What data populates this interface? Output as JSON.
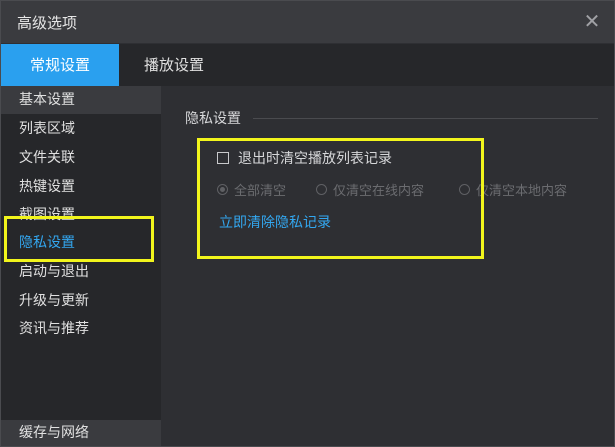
{
  "window": {
    "title": "高级选项"
  },
  "tabs": [
    {
      "label": "常规设置",
      "active": true
    },
    {
      "label": "播放设置",
      "active": false
    }
  ],
  "sidebar": {
    "items": [
      {
        "label": "基本设置"
      },
      {
        "label": "列表区域"
      },
      {
        "label": "文件关联"
      },
      {
        "label": "热键设置"
      },
      {
        "label": "截图设置"
      },
      {
        "label": "隐私设置",
        "selected": true
      },
      {
        "label": "启动与退出"
      },
      {
        "label": "升级与更新"
      },
      {
        "label": "资讯与推荐"
      }
    ],
    "bottom_item": "缓存与网络"
  },
  "privacy": {
    "section_title": "隐私设置",
    "checkbox_label": "退出时清空播放列表记录",
    "checkbox_checked": false,
    "radio_options": [
      {
        "label": "全部清空",
        "checked": true
      },
      {
        "label": "仅清空在线内容",
        "checked": false
      },
      {
        "label": "仅清空本地内容",
        "checked": false
      }
    ],
    "clear_link": "立即清除隐私记录"
  },
  "colors": {
    "accent": "#2aa0ef",
    "link": "#33a7f0",
    "highlight": "#f2f51c",
    "background": "#2e2f33"
  },
  "icons": {
    "close": "close-icon"
  }
}
